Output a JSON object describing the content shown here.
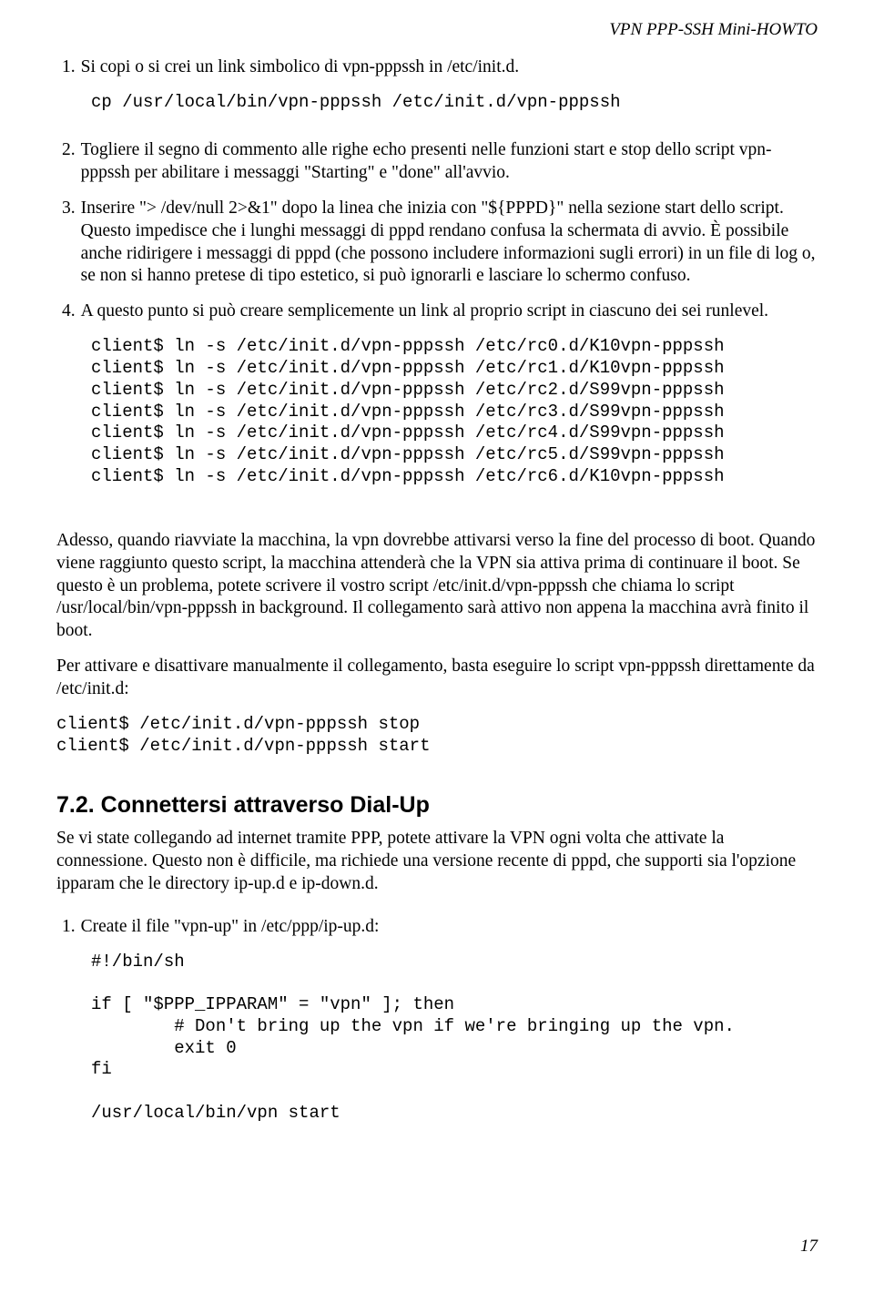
{
  "header": {
    "running": "VPN PPP-SSH Mini-HOWTO"
  },
  "items": {
    "i1": {
      "num": "1.",
      "text": "Si copi o si crei un link simbolico di vpn-pppssh in /etc/init.d."
    },
    "code1": "cp /usr/local/bin/vpn-pppssh /etc/init.d/vpn-pppssh",
    "i2": {
      "num": "2.",
      "text": "Togliere il segno di commento alle righe echo presenti nelle funzioni start e stop dello script vpn-pppssh per abilitare i messaggi \"Starting\" e \"done\" all'avvio."
    },
    "i3": {
      "num": "3.",
      "text": "Inserire \"> /dev/null 2>&1\" dopo la linea che inizia con \"${PPPD}\" nella sezione start dello script. Questo impedisce che i lunghi messaggi di pppd rendano confusa la schermata di avvio. È possibile anche ridirigere i messaggi di pppd (che possono includere informazioni sugli errori) in un file di log o, se non si hanno pretese di tipo estetico, si può ignorarli e lasciare lo schermo confuso."
    },
    "i4": {
      "num": "4.",
      "text": "A questo punto si può creare semplicemente un link al proprio script in ciascuno dei sei runlevel."
    },
    "code4": "client$ ln -s /etc/init.d/vpn-pppssh /etc/rc0.d/K10vpn-pppssh\nclient$ ln -s /etc/init.d/vpn-pppssh /etc/rc1.d/K10vpn-pppssh\nclient$ ln -s /etc/init.d/vpn-pppssh /etc/rc2.d/S99vpn-pppssh\nclient$ ln -s /etc/init.d/vpn-pppssh /etc/rc3.d/S99vpn-pppssh\nclient$ ln -s /etc/init.d/vpn-pppssh /etc/rc4.d/S99vpn-pppssh\nclient$ ln -s /etc/init.d/vpn-pppssh /etc/rc5.d/S99vpn-pppssh\nclient$ ln -s /etc/init.d/vpn-pppssh /etc/rc6.d/K10vpn-pppssh"
  },
  "paras": {
    "p1": "Adesso, quando riavviate la macchina, la vpn dovrebbe attivarsi verso la fine del processo di boot. Quando viene raggiunto questo script, la macchina attenderà che la VPN sia attiva prima di continuare il boot. Se questo è un problema, potete scrivere il vostro script /etc/init.d/vpn-pppssh che chiama lo script /usr/local/bin/vpn-pppssh in background. Il collegamento sarà attivo non appena la macchina avrà finito il boot.",
    "p2": "Per attivare e disattivare manualmente il collegamento, basta eseguire lo script vpn-pppssh direttamente da /etc/init.d:",
    "code_p2": "client$ /etc/init.d/vpn-pppssh stop\nclient$ /etc/init.d/vpn-pppssh start"
  },
  "section72": {
    "title": "7.2. Connettersi attraverso Dial-Up",
    "intro": "Se vi state collegando ad internet tramite PPP, potete attivare la VPN ogni volta che attivate la connessione. Questo non è difficile, ma richiede una versione recente di pppd, che supporti sia l'opzione ipparam che le directory ip-up.d e ip-down.d.",
    "s1": {
      "num": "1.",
      "text": "Create il file \"vpn-up\" in /etc/ppp/ip-up.d:"
    },
    "code_s1": "#!/bin/sh\n\nif [ \"$PPP_IPPARAM\" = \"vpn\" ]; then\n        # Don't bring up the vpn if we're bringing up the vpn.\n        exit 0\nfi\n\n/usr/local/bin/vpn start"
  },
  "page_number": "17"
}
